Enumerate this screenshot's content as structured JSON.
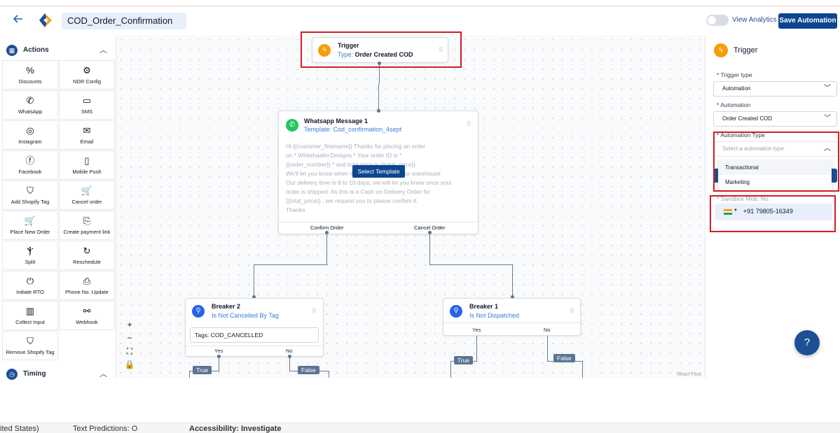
{
  "header": {
    "back_icon": "arrow-left-icon",
    "automation_name": "COD_Order_Confirmation",
    "view_analytics": "View Analytics",
    "save_label": "Save Automation",
    "brand_color": "#0d4690"
  },
  "sidebar": {
    "actions_title": "Actions",
    "timing_title": "Timing",
    "items": [
      {
        "label": "Discounts",
        "icon": "percent-icon"
      },
      {
        "label": "NDR Config",
        "icon": "gear-icon"
      },
      {
        "label": "WhatsApp",
        "icon": "whatsapp-icon"
      },
      {
        "label": "SMS",
        "icon": "sms-icon"
      },
      {
        "label": "Instagram",
        "icon": "instagram-icon"
      },
      {
        "label": "Email",
        "icon": "email-icon"
      },
      {
        "label": "Facebook",
        "icon": "facebook-icon"
      },
      {
        "label": "Mobile Push",
        "icon": "mobile-push-icon"
      },
      {
        "label": "Add Shopify Tag",
        "icon": "shopify-icon"
      },
      {
        "label": "Cancel order",
        "icon": "cart-cancel-icon"
      },
      {
        "label": "Place New Order",
        "icon": "cart-icon"
      },
      {
        "label": "Create payment link",
        "icon": "payment-link-icon"
      },
      {
        "label": "Split",
        "icon": "split-icon"
      },
      {
        "label": "Reschedule",
        "icon": "reschedule-icon"
      },
      {
        "label": "Initiate RTO",
        "icon": "power-icon"
      },
      {
        "label": "Phone No. Update",
        "icon": "phone-update-icon"
      },
      {
        "label": "Collect Input",
        "icon": "collect-input-icon"
      },
      {
        "label": "Webhook",
        "icon": "webhook-icon"
      },
      {
        "label": "Remove Shopify Tag",
        "icon": "shopify-icon"
      }
    ]
  },
  "canvas": {
    "trigger_node": {
      "title": "Trigger",
      "type_label": "Type:",
      "type_value": "Order Created COD"
    },
    "whatsapp_node": {
      "title": "Whatsapp Message 1",
      "template_label": "Template:",
      "template_value": "Cod_confirmation_4sept",
      "preview_lines": [
        "Hi {{customer_firstname}} Thanks for placing an order",
        "on * Whitehaathi Designs * Your order ID is *",
        "{{order_number}} * and total price is {{total_price}}",
        "We'll let you know when it's dispatched from our warehouse",
        "Our delivery time is 8 to 10 days, we will let you know once your",
        "order is shipped. As this is a Cash on Delivery Order for",
        "{{total_price}} , we request you to please confirm it.",
        "Thanks"
      ],
      "select_template": "Select Template",
      "out_left": "Confirm Order",
      "out_right": "Cancel Order"
    },
    "breaker2": {
      "title": "Breaker 2",
      "subtitle": "Is Not Cancelled By Tag",
      "tags": "Tags: COD_CANCELLED",
      "yes": "Yes",
      "no": "No",
      "true_label": "True",
      "false_label": "False"
    },
    "breaker1": {
      "title": "Breaker 1",
      "subtitle": "Is Not Dispatched",
      "yes": "Yes",
      "no": "No",
      "true_label": "True",
      "false_label": "False"
    },
    "zoom": {
      "plus": "+",
      "minus": "−"
    },
    "attribution": "React Flow"
  },
  "panel": {
    "title": "Trigger",
    "trigger_type_label": "* Trigger type",
    "trigger_type_value": "Automation",
    "automation_label": "* Automation",
    "automation_value": "Order Created COD",
    "automation_type_label": "* Automation Type",
    "automation_type_placeholder": "Select a automation type",
    "options": [
      "Transactional",
      "Marketing"
    ],
    "sandbox_label": "* Sandbox Mob. No.",
    "phone_value": "+91 79805-16349"
  },
  "taskbar": {
    "left_fragment": "ited States)",
    "text_predictions": "Text Predictions: O",
    "accessibility": "Accessibility: Investigate"
  }
}
